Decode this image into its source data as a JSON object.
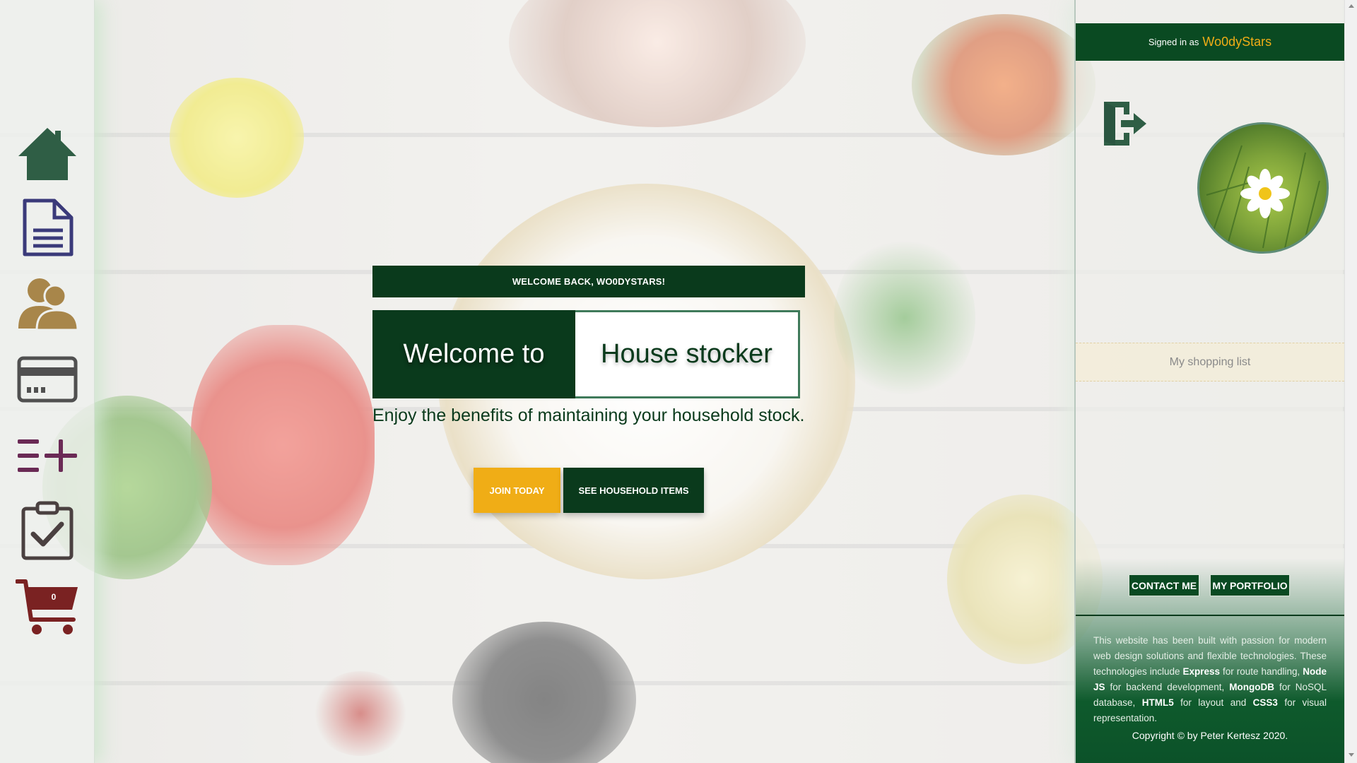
{
  "nav": {
    "items": [
      {
        "name": "home-icon",
        "color": "#2f5e45"
      },
      {
        "name": "document-icon",
        "color": "#3a3a7a"
      },
      {
        "name": "users-icon",
        "color": "#a8864a"
      },
      {
        "name": "credit-card-icon",
        "color": "#505050"
      },
      {
        "name": "add-list-icon",
        "color": "#6a2a55"
      },
      {
        "name": "clipboard-check-icon",
        "color": "#4a4040"
      },
      {
        "name": "cart-icon",
        "color": "#7a2222"
      }
    ],
    "cart_count": "0"
  },
  "main": {
    "welcome_back": "WELCOME BACK, WO0DYSTARS!",
    "title_left": "Welcome to",
    "title_right": "House stocker",
    "tagline": "Enjoy the benefits of maintaining your household stock.",
    "join_label": "JOIN TODAY",
    "items_label": "SEE HOUSEHOLD ITEMS"
  },
  "sidebar": {
    "signed_in_label": "Signed in as",
    "username": "Wo0dyStars",
    "shopping_list_label": "My shopping list",
    "contact_label": "CONTACT ME",
    "portfolio_label": "MY PORTFOLIO",
    "footer": {
      "p1": "This website has been built with passion for modern web design solutions and flexible technologies. These technologies include",
      "t1": "Express",
      "p2": "for route handling,",
      "t2": "Node JS",
      "p3": "for backend development,",
      "t3": "MongoDB",
      "p4": "for NoSQL database,",
      "t4": "HTML5",
      "p5": "for layout and",
      "t5": "CSS3",
      "p6": "for visual representation."
    },
    "copyright": "Copyright © by Peter Kertesz 2020."
  },
  "colors": {
    "brand_dark": "#0a3a1c",
    "accent": "#f0ad16"
  }
}
